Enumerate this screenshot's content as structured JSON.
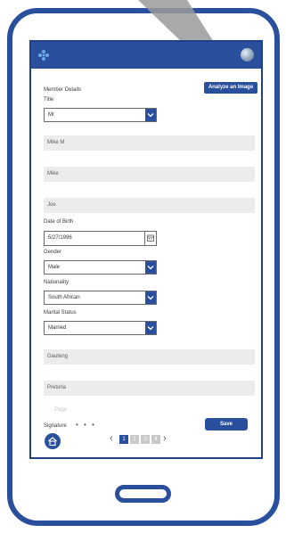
{
  "app": {
    "analyze_label": "Analyze an Image",
    "save_label": "Save"
  },
  "form": {
    "section_title": "Member Details",
    "title_label": "Title",
    "title_value": "Mr",
    "name_value": "Mike M",
    "first_name_value": "Mike",
    "surname_value": "Joe",
    "dob_label": "Date of Birth",
    "dob_value": "5/27/1996",
    "gender_label": "Gender",
    "gender_value": "Male",
    "nationality_label": "Nationality",
    "nationality_value": "South African",
    "marital_label": "Marital Status",
    "marital_value": "Married",
    "city_value": "Pretoria",
    "state_value": "Gauteng",
    "faded_label": "Page",
    "signature_label": "Signature",
    "signature_dots": "• • •"
  },
  "pager": {
    "prev": "‹",
    "next": "›",
    "pages": [
      "1",
      "2",
      "3",
      "4"
    ]
  },
  "colors": {
    "brand": "#2a4f9c",
    "field_bg": "#ececec"
  },
  "icons": {
    "logo": "asterisk-logo-icon",
    "home": "home-icon",
    "calendar": "calendar-icon",
    "caret": "chevron-down-icon"
  }
}
